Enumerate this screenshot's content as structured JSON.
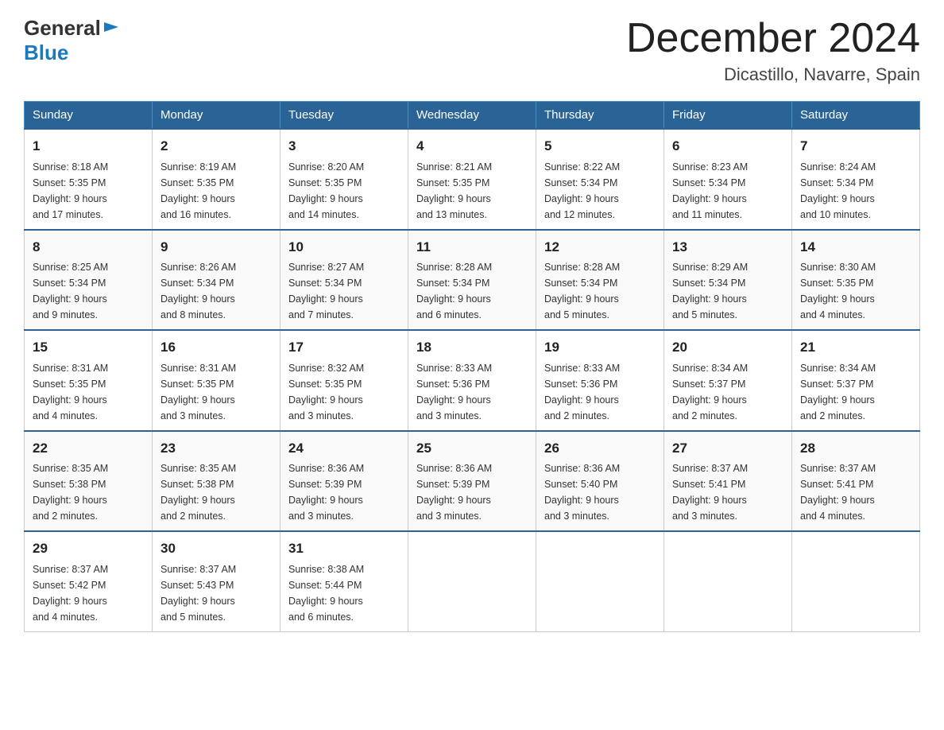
{
  "header": {
    "logo": {
      "general": "General",
      "blue": "Blue"
    },
    "title": "December 2024",
    "location": "Dicastillo, Navarre, Spain"
  },
  "weekdays": [
    "Sunday",
    "Monday",
    "Tuesday",
    "Wednesday",
    "Thursday",
    "Friday",
    "Saturday"
  ],
  "weeks": [
    [
      {
        "day": "1",
        "sunrise": "8:18 AM",
        "sunset": "5:35 PM",
        "daylight": "9 hours and 17 minutes."
      },
      {
        "day": "2",
        "sunrise": "8:19 AM",
        "sunset": "5:35 PM",
        "daylight": "9 hours and 16 minutes."
      },
      {
        "day": "3",
        "sunrise": "8:20 AM",
        "sunset": "5:35 PM",
        "daylight": "9 hours and 14 minutes."
      },
      {
        "day": "4",
        "sunrise": "8:21 AM",
        "sunset": "5:35 PM",
        "daylight": "9 hours and 13 minutes."
      },
      {
        "day": "5",
        "sunrise": "8:22 AM",
        "sunset": "5:34 PM",
        "daylight": "9 hours and 12 minutes."
      },
      {
        "day": "6",
        "sunrise": "8:23 AM",
        "sunset": "5:34 PM",
        "daylight": "9 hours and 11 minutes."
      },
      {
        "day": "7",
        "sunrise": "8:24 AM",
        "sunset": "5:34 PM",
        "daylight": "9 hours and 10 minutes."
      }
    ],
    [
      {
        "day": "8",
        "sunrise": "8:25 AM",
        "sunset": "5:34 PM",
        "daylight": "9 hours and 9 minutes."
      },
      {
        "day": "9",
        "sunrise": "8:26 AM",
        "sunset": "5:34 PM",
        "daylight": "9 hours and 8 minutes."
      },
      {
        "day": "10",
        "sunrise": "8:27 AM",
        "sunset": "5:34 PM",
        "daylight": "9 hours and 7 minutes."
      },
      {
        "day": "11",
        "sunrise": "8:28 AM",
        "sunset": "5:34 PM",
        "daylight": "9 hours and 6 minutes."
      },
      {
        "day": "12",
        "sunrise": "8:28 AM",
        "sunset": "5:34 PM",
        "daylight": "9 hours and 5 minutes."
      },
      {
        "day": "13",
        "sunrise": "8:29 AM",
        "sunset": "5:34 PM",
        "daylight": "9 hours and 5 minutes."
      },
      {
        "day": "14",
        "sunrise": "8:30 AM",
        "sunset": "5:35 PM",
        "daylight": "9 hours and 4 minutes."
      }
    ],
    [
      {
        "day": "15",
        "sunrise": "8:31 AM",
        "sunset": "5:35 PM",
        "daylight": "9 hours and 4 minutes."
      },
      {
        "day": "16",
        "sunrise": "8:31 AM",
        "sunset": "5:35 PM",
        "daylight": "9 hours and 3 minutes."
      },
      {
        "day": "17",
        "sunrise": "8:32 AM",
        "sunset": "5:35 PM",
        "daylight": "9 hours and 3 minutes."
      },
      {
        "day": "18",
        "sunrise": "8:33 AM",
        "sunset": "5:36 PM",
        "daylight": "9 hours and 3 minutes."
      },
      {
        "day": "19",
        "sunrise": "8:33 AM",
        "sunset": "5:36 PM",
        "daylight": "9 hours and 2 minutes."
      },
      {
        "day": "20",
        "sunrise": "8:34 AM",
        "sunset": "5:37 PM",
        "daylight": "9 hours and 2 minutes."
      },
      {
        "day": "21",
        "sunrise": "8:34 AM",
        "sunset": "5:37 PM",
        "daylight": "9 hours and 2 minutes."
      }
    ],
    [
      {
        "day": "22",
        "sunrise": "8:35 AM",
        "sunset": "5:38 PM",
        "daylight": "9 hours and 2 minutes."
      },
      {
        "day": "23",
        "sunrise": "8:35 AM",
        "sunset": "5:38 PM",
        "daylight": "9 hours and 2 minutes."
      },
      {
        "day": "24",
        "sunrise": "8:36 AM",
        "sunset": "5:39 PM",
        "daylight": "9 hours and 3 minutes."
      },
      {
        "day": "25",
        "sunrise": "8:36 AM",
        "sunset": "5:39 PM",
        "daylight": "9 hours and 3 minutes."
      },
      {
        "day": "26",
        "sunrise": "8:36 AM",
        "sunset": "5:40 PM",
        "daylight": "9 hours and 3 minutes."
      },
      {
        "day": "27",
        "sunrise": "8:37 AM",
        "sunset": "5:41 PM",
        "daylight": "9 hours and 3 minutes."
      },
      {
        "day": "28",
        "sunrise": "8:37 AM",
        "sunset": "5:41 PM",
        "daylight": "9 hours and 4 minutes."
      }
    ],
    [
      {
        "day": "29",
        "sunrise": "8:37 AM",
        "sunset": "5:42 PM",
        "daylight": "9 hours and 4 minutes."
      },
      {
        "day": "30",
        "sunrise": "8:37 AM",
        "sunset": "5:43 PM",
        "daylight": "9 hours and 5 minutes."
      },
      {
        "day": "31",
        "sunrise": "8:38 AM",
        "sunset": "5:44 PM",
        "daylight": "9 hours and 6 minutes."
      },
      null,
      null,
      null,
      null
    ]
  ],
  "labels": {
    "sunrise": "Sunrise:",
    "sunset": "Sunset:",
    "daylight": "Daylight:"
  }
}
